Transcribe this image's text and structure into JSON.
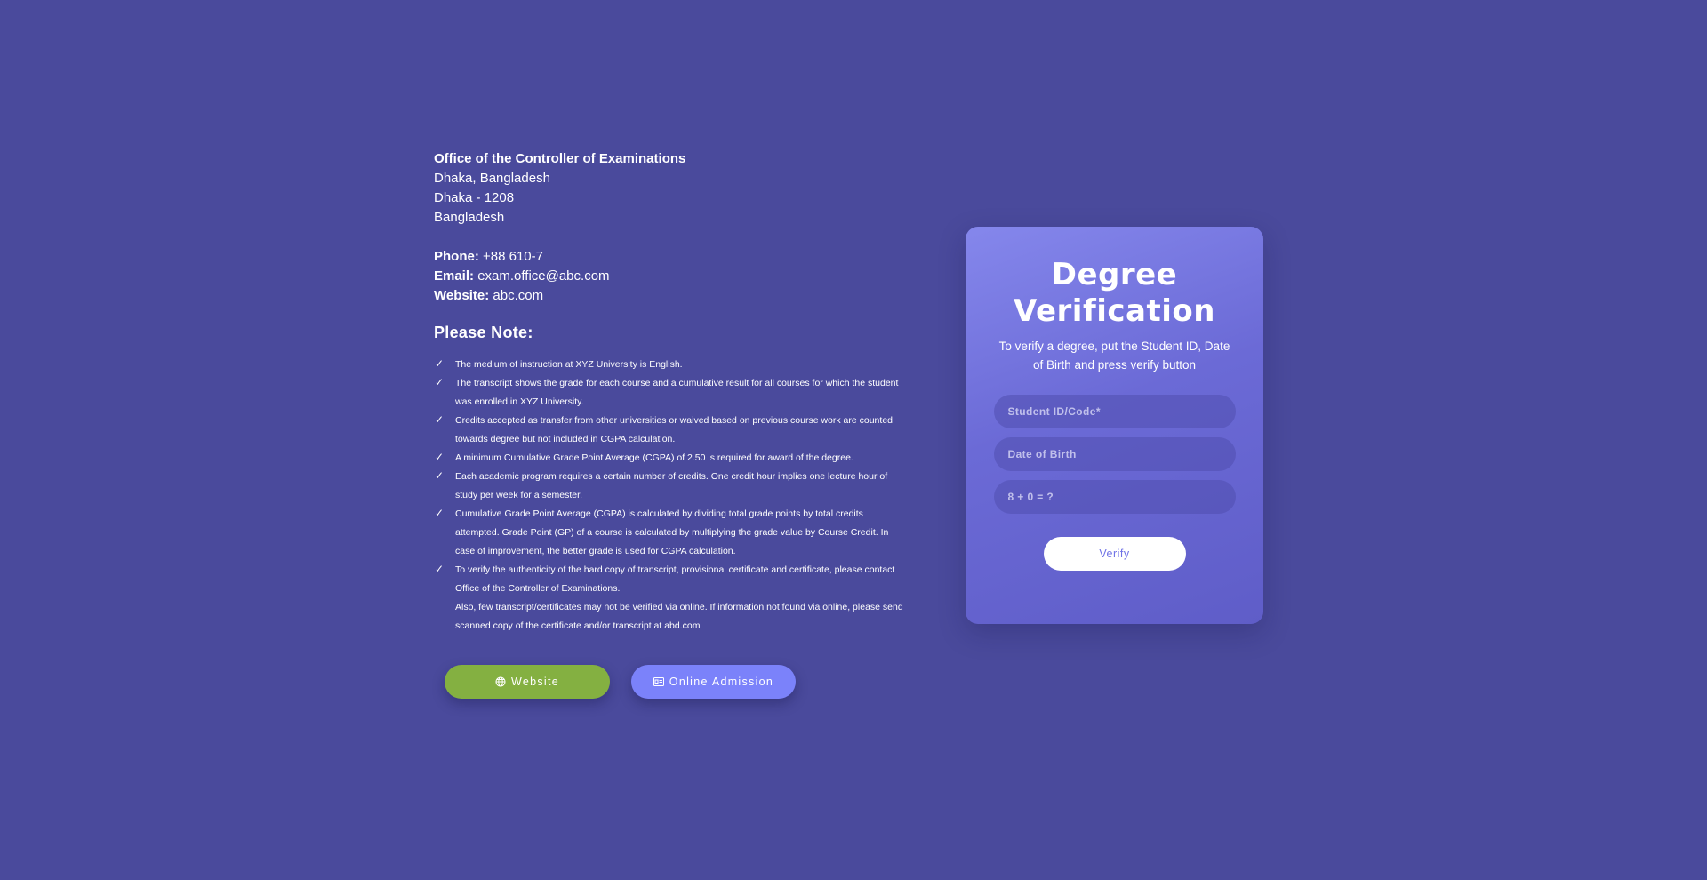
{
  "office": {
    "title": "Office of the Controller of Examinations",
    "lines": [
      "Dhaka, Bangladesh",
      "Dhaka - 1208",
      "Bangladesh"
    ]
  },
  "contact": {
    "phone_label": "Phone:",
    "phone_value": "+88 610-7",
    "email_label": "Email:",
    "email_value": "exam.office@abc.com",
    "website_label": "Website:",
    "website_value": "abc.com"
  },
  "notes": {
    "title": "Please Note:",
    "items": [
      "The medium of instruction at XYZ University is English.",
      "The transcript shows the grade for each course and a cumulative result for all courses for which the student was enrolled in XYZ University.",
      "Credits accepted as transfer from other universities or waived based on previous course work are counted towards degree but not included in CGPA calculation.",
      "A minimum Cumulative Grade Point Average (CGPA) of 2.50 is required for award of the degree.",
      "Each academic program requires a certain number of credits. One credit hour implies one lecture hour of study per week for a semester.",
      "Cumulative Grade Point Average (CGPA) is calculated by dividing total grade points by total credits attempted. Grade Point (GP) of a course is calculated by multiplying the grade value by Course Credit. In case of improvement, the better grade is used for CGPA calculation.",
      "To verify the authenticity of the hard copy of transcript, provisional certificate and certificate, please contact Office of the Controller of Examinations."
    ],
    "extra": "Also, few transcript/certificates may not be verified via online. If information not found via online, please send scanned copy of the certificate and/or transcript at abd.com"
  },
  "buttons": {
    "website_label": "Website",
    "admission_label": "Online Admission"
  },
  "form": {
    "title": "Degree Verification",
    "subtitle": "To verify a degree, put the Student ID, Date of Birth and press verify button",
    "student_id_placeholder": "Student ID/Code*",
    "dob_placeholder": "Date of Birth",
    "captcha_placeholder": "8 + 0 = ?",
    "verify_label": "Verify"
  },
  "icons": {
    "check": "check-icon",
    "website": "globe-icon",
    "admission": "id-card-icon"
  },
  "colors": {
    "background": "#4a4a9c",
    "website_button": "#84b041",
    "admission_button": "#7b82fa",
    "verify_text": "#6f72e6"
  }
}
